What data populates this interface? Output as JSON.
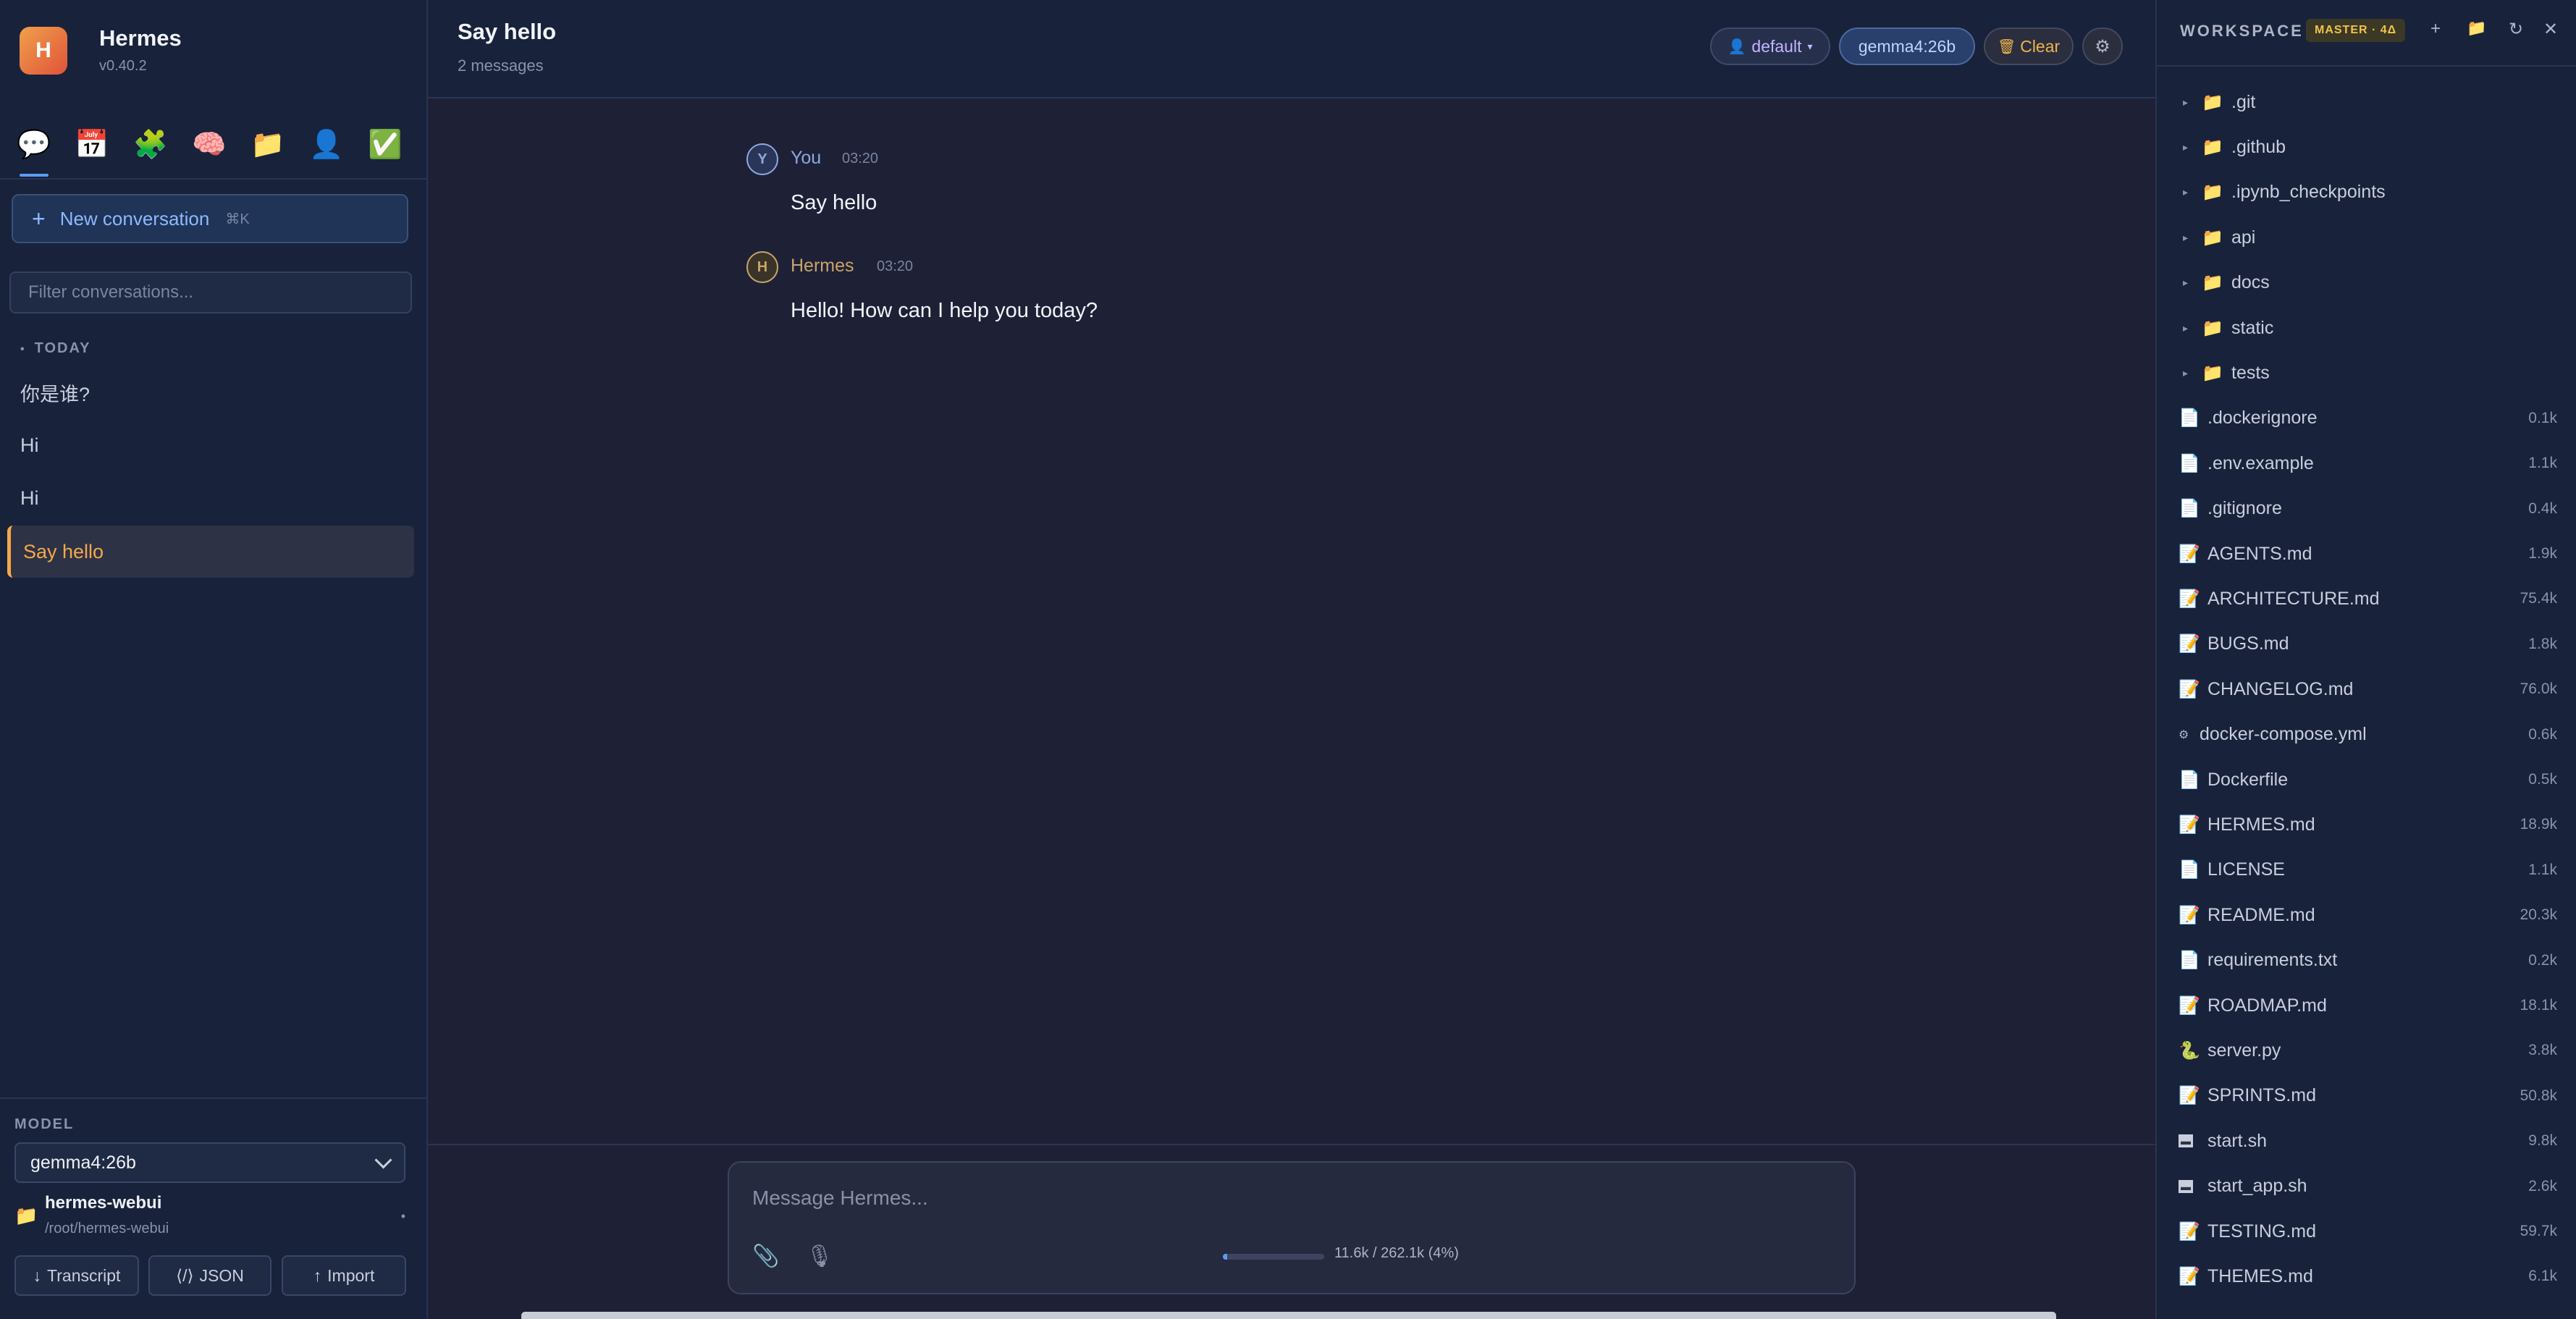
{
  "app": {
    "name": "Hermes",
    "version": "v0.40.2",
    "logo_letter": "H"
  },
  "nav_icons": [
    {
      "icon": "chat-icon",
      "glyph": "💬",
      "active": true
    },
    {
      "icon": "calendar-icon",
      "glyph": "📅",
      "active": false
    },
    {
      "icon": "puzzle-icon",
      "glyph": "🧩",
      "active": false
    },
    {
      "icon": "brain-icon",
      "glyph": "🧠",
      "active": false
    },
    {
      "icon": "folder-icon",
      "glyph": "📁",
      "active": false
    },
    {
      "icon": "person-icon",
      "glyph": "👤",
      "active": false
    },
    {
      "icon": "check-icon",
      "glyph": "✅",
      "active": false
    }
  ],
  "sidebar": {
    "new_conversation": {
      "label": "New conversation",
      "shortcut": "⌘K"
    },
    "filter_placeholder": "Filter conversations...",
    "section_title": "TODAY",
    "conversations": [
      {
        "title": "你是谁?",
        "active": false
      },
      {
        "title": "Hi",
        "active": false
      },
      {
        "title": "Hi",
        "active": false
      },
      {
        "title": "Say hello",
        "active": true
      }
    ],
    "model_label": "MODEL",
    "model_value": "gemma4:26b",
    "workspace": {
      "name": "hermes-webui",
      "path": "/root/hermes-webui"
    },
    "buttons": [
      {
        "icon": "↓",
        "label": "Transcript"
      },
      {
        "icon": "⟨/⟩",
        "label": "JSON"
      },
      {
        "icon": "↑",
        "label": "Import"
      }
    ]
  },
  "chat": {
    "title": "Say hello",
    "subtitle": "2 messages",
    "profile_pill": "default",
    "model_pill": "gemma4:26b",
    "clear_label": "Clear",
    "messages": [
      {
        "avatar": "Y",
        "sender": "You",
        "time": "03:20",
        "text": "Say hello",
        "color": "#8fa8e0"
      },
      {
        "avatar": "H",
        "sender": "Hermes",
        "time": "03:20",
        "text": "Hello! How can I help you today?",
        "color": "#c9a46a"
      }
    ],
    "composer_placeholder": "Message Hermes...",
    "context": {
      "text": "11.6k / 262.1k (4%)",
      "percent": 4
    }
  },
  "workspace_panel": {
    "title": "WORKSPACE",
    "branch": "MASTER · 4Δ",
    "entries": [
      {
        "name": ".git",
        "type": "dir",
        "size": ""
      },
      {
        "name": ".github",
        "type": "dir",
        "size": ""
      },
      {
        "name": ".ipynb_checkpoints",
        "type": "dir",
        "size": ""
      },
      {
        "name": "api",
        "type": "dir",
        "size": ""
      },
      {
        "name": "docs",
        "type": "dir",
        "size": ""
      },
      {
        "name": "static",
        "type": "dir",
        "size": ""
      },
      {
        "name": "tests",
        "type": "dir",
        "size": ""
      },
      {
        "name": ".dockerignore",
        "type": "file",
        "size": "0.1k"
      },
      {
        "name": ".env.example",
        "type": "file",
        "size": "1.1k"
      },
      {
        "name": ".gitignore",
        "type": "file",
        "size": "0.4k"
      },
      {
        "name": "AGENTS.md",
        "type": "md",
        "size": "1.9k"
      },
      {
        "name": "ARCHITECTURE.md",
        "type": "md",
        "size": "75.4k"
      },
      {
        "name": "BUGS.md",
        "type": "md",
        "size": "1.8k"
      },
      {
        "name": "CHANGELOG.md",
        "type": "md",
        "size": "76.0k"
      },
      {
        "name": "docker-compose.yml",
        "type": "yml",
        "size": "0.6k"
      },
      {
        "name": "Dockerfile",
        "type": "file",
        "size": "0.5k"
      },
      {
        "name": "HERMES.md",
        "type": "md",
        "size": "18.9k"
      },
      {
        "name": "LICENSE",
        "type": "file",
        "size": "1.1k"
      },
      {
        "name": "README.md",
        "type": "md",
        "size": "20.3k"
      },
      {
        "name": "requirements.txt",
        "type": "file",
        "size": "0.2k"
      },
      {
        "name": "ROADMAP.md",
        "type": "md",
        "size": "18.1k"
      },
      {
        "name": "server.py",
        "type": "py",
        "size": "3.8k"
      },
      {
        "name": "SPRINTS.md",
        "type": "md",
        "size": "50.8k"
      },
      {
        "name": "start.sh",
        "type": "sh",
        "size": "9.8k"
      },
      {
        "name": "start_app.sh",
        "type": "sh",
        "size": "2.6k"
      },
      {
        "name": "TESTING.md",
        "type": "md",
        "size": "59.7k"
      },
      {
        "name": "THEMES.md",
        "type": "md",
        "size": "6.1k"
      }
    ]
  }
}
